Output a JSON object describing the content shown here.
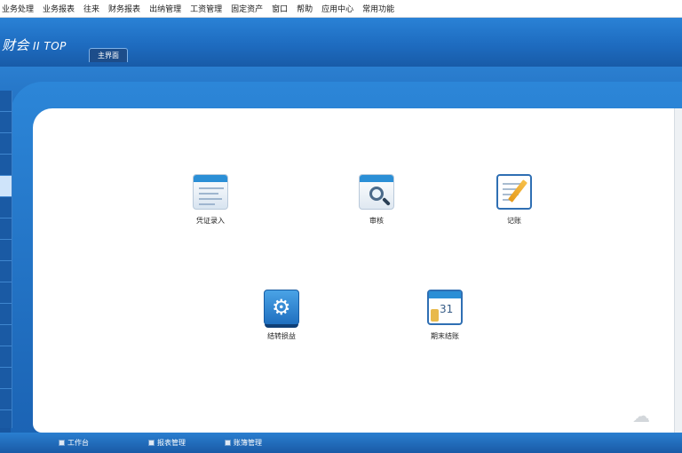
{
  "menu": {
    "items": [
      "业务处理",
      "业务报表",
      "往来",
      "财务报表",
      "出纳管理",
      "工资管理",
      "固定资产",
      "窗口",
      "帮助",
      "应用中心",
      "常用功能"
    ]
  },
  "header": {
    "logo_cn": "财会",
    "logo_suffix": "II TOP",
    "tab_main": "主界面"
  },
  "tiles": {
    "voucher_entry": "凭证录入",
    "audit": "审核",
    "posting": "记账",
    "settings": "结转损益",
    "period_end": "期末结账",
    "period_end_day": "31"
  },
  "icons": {
    "voucher_entry": "voucher-form-icon",
    "audit": "magnifier-document-icon",
    "posting": "notepad-pen-icon",
    "settings": "gear-icon",
    "period_end": "calendar-icon",
    "bottom_tab": "window-icon"
  },
  "bottom": {
    "tabs": [
      "工作台",
      "报表管理",
      "账簿管理"
    ]
  },
  "colors": {
    "brand_blue": "#1e6cc0",
    "panel_bg": "#ffffff"
  }
}
